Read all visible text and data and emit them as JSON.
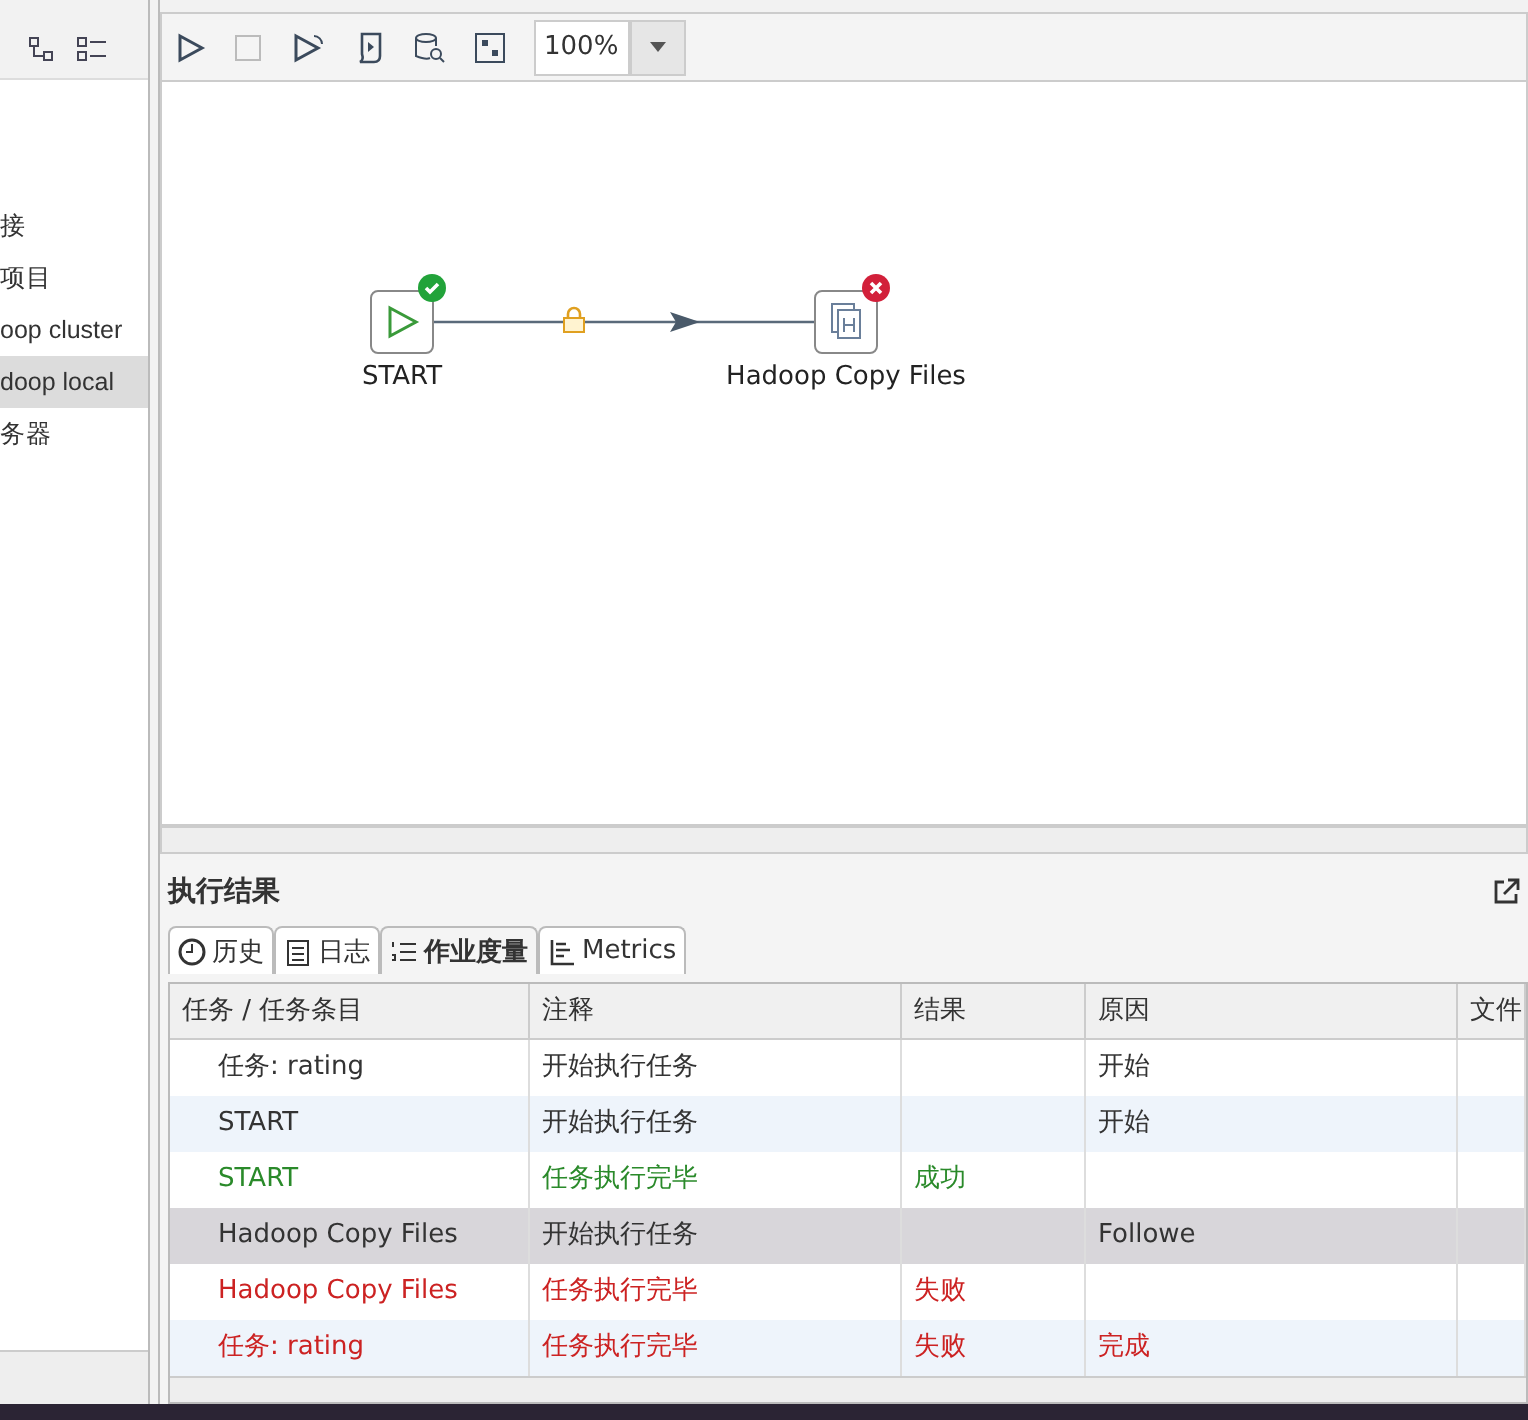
{
  "sidebar": {
    "items": [
      {
        "label": "接",
        "selected": false
      },
      {
        "label": "项目",
        "selected": false
      },
      {
        "label": "oop cluster",
        "selected": false
      },
      {
        "label": "doop local",
        "selected": true
      },
      {
        "label": "务器",
        "selected": false
      }
    ]
  },
  "toolbar": {
    "zoom": "100%"
  },
  "canvas": {
    "nodes": [
      {
        "label": "START",
        "kind": "start",
        "badge": {
          "kind": "success"
        }
      },
      {
        "label": "Hadoop Copy Files",
        "kind": "hadoop",
        "badge": {
          "kind": "error"
        }
      }
    ]
  },
  "results": {
    "title": "执行结果",
    "tabs": [
      {
        "label": "历史",
        "kind": "history",
        "selected": false
      },
      {
        "label": "日志",
        "kind": "log",
        "selected": false
      },
      {
        "label": "作业度量",
        "kind": "metrics-list",
        "selected": true
      },
      {
        "label": "Metrics",
        "kind": "chart",
        "selected": false
      }
    ],
    "columns": [
      "任务 / 任务条目",
      "注释",
      "结果",
      "原因",
      "文件"
    ],
    "rows": [
      {
        "cells": [
          "任务: rating",
          "开始执行任务",
          "",
          "开始"
        ],
        "color": "#333333",
        "selected": false
      },
      {
        "cells": [
          "START",
          "开始执行任务",
          "",
          "开始"
        ],
        "color": "#333333",
        "selected": false
      },
      {
        "cells": [
          "START",
          "任务执行完毕",
          "成功",
          ""
        ],
        "color": "#2a8a2a",
        "selected": false
      },
      {
        "cells": [
          "Hadoop Copy Files",
          "开始执行任务",
          "",
          "Followe"
        ],
        "color": "#333333",
        "selected": true
      },
      {
        "cells": [
          "Hadoop Copy Files",
          "任务执行完毕",
          "失败",
          ""
        ],
        "color": "#cc2222",
        "selected": false
      },
      {
        "cells": [
          "任务: rating",
          "任务执行完毕",
          "失败",
          "完成"
        ],
        "color": "#cc2222",
        "selected": false
      }
    ]
  }
}
